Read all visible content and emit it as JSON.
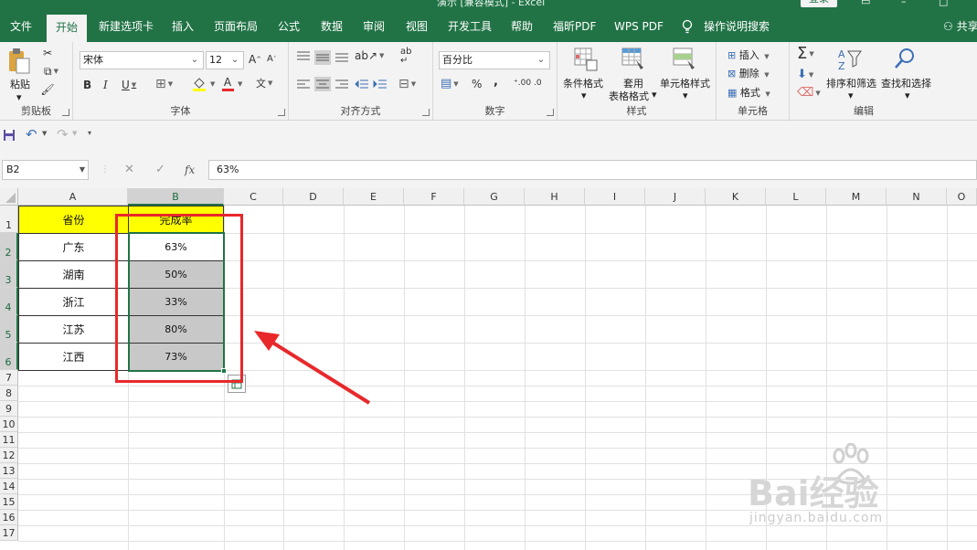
{
  "window": {
    "title": "演示 [兼容模式] - Excel",
    "login_label": "登录",
    "share_label": "共享"
  },
  "menu": {
    "tabs": [
      {
        "label": "文件"
      },
      {
        "label": "开始",
        "active": true
      },
      {
        "label": "新建选项卡"
      },
      {
        "label": "插入"
      },
      {
        "label": "页面布局"
      },
      {
        "label": "公式"
      },
      {
        "label": "数据"
      },
      {
        "label": "审阅"
      },
      {
        "label": "视图"
      },
      {
        "label": "开发工具"
      },
      {
        "label": "帮助"
      },
      {
        "label": "福昕PDF"
      },
      {
        "label": "WPS PDF"
      },
      {
        "label": "操作说明搜索"
      }
    ]
  },
  "ribbon": {
    "clipboard": {
      "label": "剪贴板",
      "paste_label": "粘贴"
    },
    "font": {
      "label": "字体",
      "font_name": "宋体",
      "font_size": "12",
      "bold": "B",
      "italic": "I",
      "underline": "U",
      "grow": "A",
      "shrink": "A",
      "font_color_glyph": "A",
      "phonetic": "文"
    },
    "align": {
      "label": "对齐方式"
    },
    "number": {
      "label": "数字",
      "format": "百分比",
      "percent": "%",
      "comma": ",",
      "inc_decimal": ".00",
      "dec_decimal": ".0"
    },
    "styles": {
      "label": "样式",
      "conditional": "条件格式",
      "table_line1": "套用",
      "table_line2": "表格格式",
      "cell_styles": "单元格样式"
    },
    "cells": {
      "label": "单元格",
      "insert": "插入",
      "delete": "删除",
      "format": "格式"
    },
    "editing": {
      "label": "编辑",
      "sum_glyph": "Σ",
      "sort_filter": "排序和筛选",
      "find_select": "查找和选择"
    }
  },
  "formula_bar": {
    "name_box": "B2",
    "fx_label": "fx",
    "value": "63%"
  },
  "grid": {
    "columns": [
      "A",
      "B",
      "C",
      "D",
      "E",
      "F",
      "G",
      "H",
      "I",
      "J",
      "K",
      "L",
      "M",
      "N",
      "O"
    ],
    "rows": [
      "1",
      "2",
      "3",
      "4",
      "5",
      "6",
      "7",
      "8",
      "9",
      "10",
      "11",
      "12",
      "13",
      "14",
      "15",
      "16",
      "17"
    ],
    "headers": [
      "省份",
      "完成率"
    ],
    "data": [
      [
        "广东",
        "63%"
      ],
      [
        "湖南",
        "50%"
      ],
      [
        "浙江",
        "33%"
      ],
      [
        "江苏",
        "80%"
      ],
      [
        "江西",
        "73%"
      ]
    ]
  },
  "colors": {
    "ribbon_green": "#217346",
    "header_fill": "#ffff00",
    "selection_fill": "#c8c8c8",
    "annotation": "#e8282b"
  },
  "watermark": {
    "brand": "Bai经验",
    "url": "jingyan.baidu.com"
  }
}
